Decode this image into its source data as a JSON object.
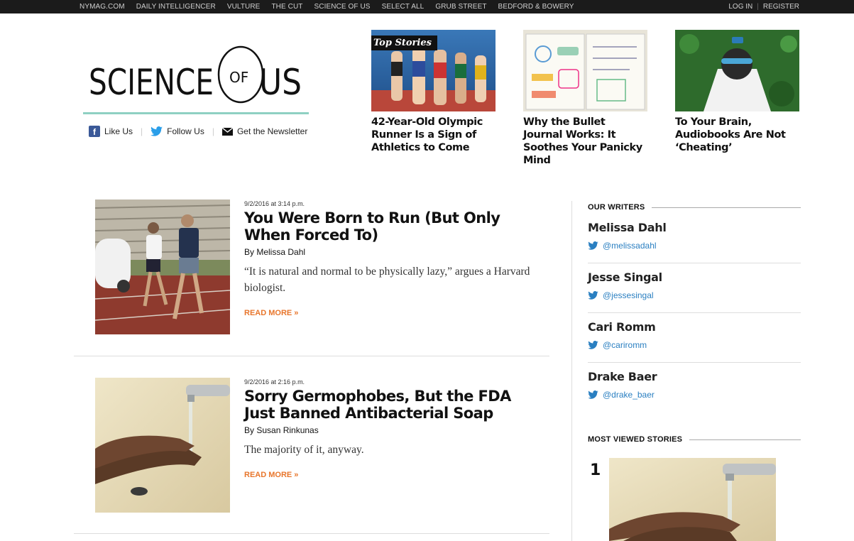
{
  "topnav": {
    "links": [
      "NYMAG.COM",
      "DAILY INTELLIGENCER",
      "VULTURE",
      "THE CUT",
      "SCIENCE OF US",
      "SELECT ALL",
      "GRUB STREET",
      "BEDFORD & BOWERY"
    ],
    "login": "LOG IN",
    "register": "REGISTER"
  },
  "logo": {
    "word1": "SCIENCE",
    "word2": "OF",
    "word3": "US"
  },
  "social": {
    "like": "Like Us",
    "follow": "Follow Us",
    "newsletter": "Get the Newsletter"
  },
  "top_stories": {
    "badge": "Top Stories",
    "items": [
      {
        "title": "42-Year-Old Olympic Runner Is a Sign of Athletics to Come"
      },
      {
        "title": "Why the Bullet Journal Works: It Soothes Your Panicky Mind"
      },
      {
        "title": "To Your Brain, Audiobooks Are Not ‘Cheating’"
      }
    ]
  },
  "articles": [
    {
      "date": "9/2/2016 at 3:14 p.m.",
      "headline": "You Were Born to Run (But Only When Forced To)",
      "byline": "By Melissa Dahl",
      "dek": "“It is natural and normal to be physically lazy,” argues a Harvard biologist.",
      "more": "READ MORE »"
    },
    {
      "date": "9/2/2016 at 2:16 p.m.",
      "headline": "Sorry Germophobes, But the FDA Just Banned Antibacterial Soap",
      "byline": "By Susan Rinkunas",
      "dek": "The majority of it, anyway.",
      "more": "READ MORE »"
    }
  ],
  "sidebar": {
    "writers_heading": "OUR WRITERS",
    "writers": [
      {
        "name": "Melissa Dahl",
        "handle": "@melissadahl"
      },
      {
        "name": "Jesse Singal",
        "handle": "@jessesingal"
      },
      {
        "name": "Cari Romm",
        "handle": "@cariromm"
      },
      {
        "name": "Drake Baer",
        "handle": "@drake_baer"
      }
    ],
    "most_viewed_heading": "MOST VIEWED STORIES",
    "most_viewed": [
      {
        "rank": "1"
      }
    ]
  },
  "colors": {
    "accent_orange": "#e8762c",
    "twitter_blue": "#2a7fc1",
    "logo_rule": "#8fd0c2",
    "facebook": "#3b5998"
  }
}
